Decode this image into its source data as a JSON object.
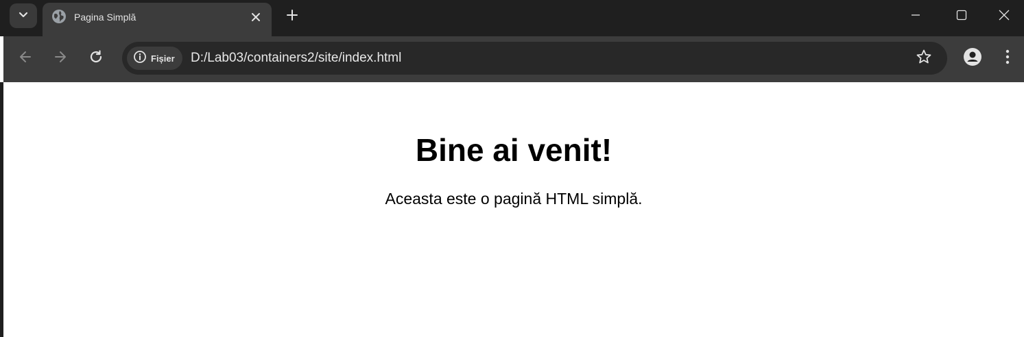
{
  "browser": {
    "tab": {
      "title": "Pagina Simplă",
      "favicon": "globe-icon"
    },
    "toolbar": {
      "site_info_label": "Fișier",
      "url": "D:/Lab03/containers2/site/index.html"
    },
    "colors": {
      "tabstrip": "#1f1f1f",
      "toolbar": "#3c3c3c",
      "omnibox": "#282828",
      "text": "#e3e3e3"
    },
    "icons": {
      "tab_search": "chevron-down-icon",
      "tab_close": "close-icon",
      "new_tab": "plus-icon",
      "back": "arrow-left-icon",
      "forward": "arrow-right-icon",
      "reload": "reload-icon",
      "site_info": "info-icon",
      "bookmark": "star-icon",
      "profile": "person-icon",
      "menu": "kebab-menu-icon",
      "minimize": "minimize-icon",
      "maximize": "maximize-icon",
      "close_window": "close-icon"
    }
  },
  "page": {
    "heading": "Bine ai venit!",
    "paragraph": "Aceasta este o pagină HTML simplă."
  }
}
